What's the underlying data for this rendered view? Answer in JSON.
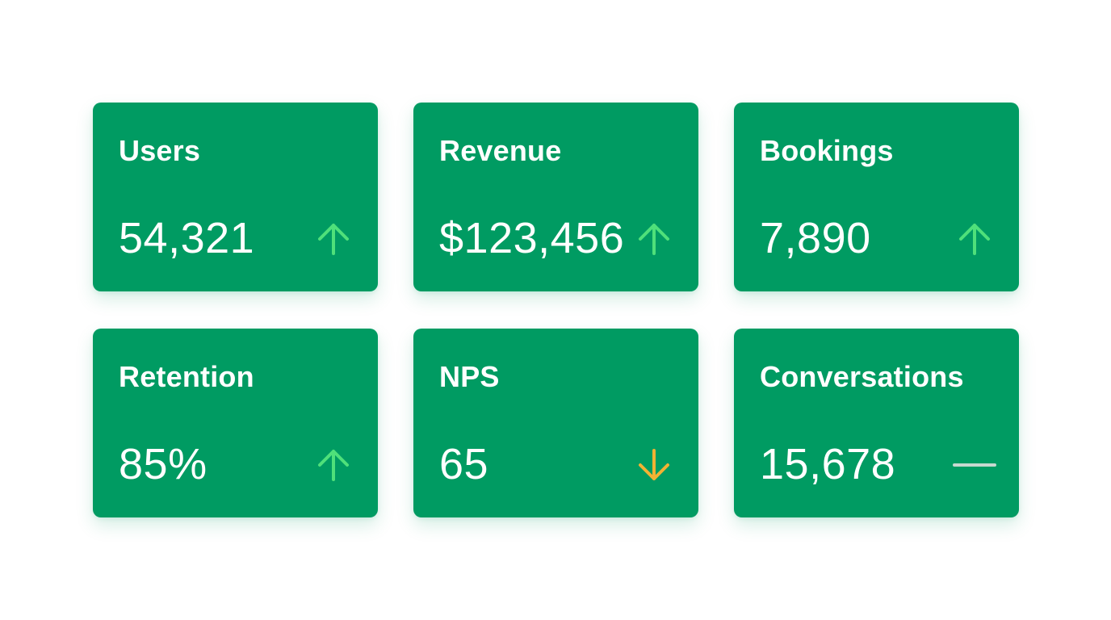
{
  "colors": {
    "card_bg": "#009b62",
    "text": "#ffffff",
    "trend_up": "#4fe07a",
    "trend_down": "#f2b233",
    "trend_flat": "#c7d9d0"
  },
  "cards": [
    {
      "label": "Users",
      "value": "54,321",
      "trend": "up",
      "trend_icon": "arrow-up-icon"
    },
    {
      "label": "Revenue",
      "value": "$123,456",
      "trend": "up",
      "trend_icon": "arrow-up-icon"
    },
    {
      "label": "Bookings",
      "value": "7,890",
      "trend": "up",
      "trend_icon": "arrow-up-icon"
    },
    {
      "label": "Retention",
      "value": "85%",
      "trend": "up",
      "trend_icon": "arrow-up-icon"
    },
    {
      "label": "NPS",
      "value": "65",
      "trend": "down",
      "trend_icon": "arrow-down-icon"
    },
    {
      "label": "Conversations",
      "value": "15,678",
      "trend": "flat",
      "trend_icon": "dash-icon"
    }
  ]
}
